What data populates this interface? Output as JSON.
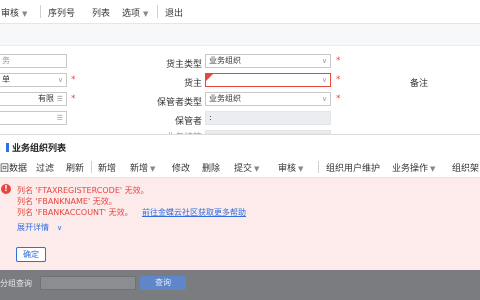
{
  "toolbar": {
    "audit_label": "审核",
    "serial_label": "序列号",
    "list_label": "列表",
    "options_label": "选项",
    "exit_label": "退出"
  },
  "form": {
    "left_field_1": "务",
    "left_field_2": "单",
    "left_field_3_value": "有限",
    "owner_type_label": "货主类型",
    "owner_type_value": "业务组织",
    "owner_label": "货主",
    "owner_value": "",
    "custodian_type_label": "保管者类型",
    "custodian_type_value": "业务组织",
    "custodian_label": "保管者",
    "custodian_value": ":",
    "truncated_label": "业务结算",
    "remarks_label": "备注"
  },
  "dialog": {
    "title": "业务组织列表",
    "toolbar": {
      "return_data": "回数据",
      "filter": "过滤",
      "refresh": "刷新",
      "new": "新增",
      "new_dd": "新增",
      "modify": "修改",
      "delete": "删除",
      "submit": "提交",
      "audit": "审核",
      "org_user_maintain": "组织用户维护",
      "business_ops": "业务操作",
      "org_arch": "组织架"
    },
    "errors": [
      "列名 'FTAXREGISTERCODE' 无效。",
      "列名 'FBANKNAME' 无效。",
      "列名 'FBANKACCOUNT' 无效。"
    ],
    "help_link": "前往金蝶云社区获取更多帮助",
    "expand_details": "展开详情",
    "ok_label": "确定"
  },
  "bottom": {
    "group_query_label": "分组查询",
    "query_label": "查询"
  },
  "colors": {
    "error": "#e8453c",
    "link": "#2f6fde",
    "error_bg": "#fdeaea"
  }
}
